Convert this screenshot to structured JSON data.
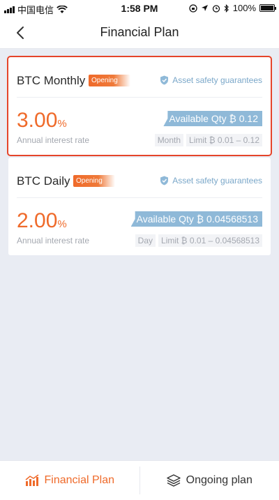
{
  "status_bar": {
    "carrier": "中国电信",
    "time": "1:58 PM",
    "battery": "100%"
  },
  "nav": {
    "title": "Financial Plan"
  },
  "plans": [
    {
      "name": "BTC Monthly",
      "badge": "Opening",
      "safety": "Asset safety guarantees",
      "rate": "3.00",
      "rate_unit": "%",
      "rate_label": "Annual interest rate",
      "available": "Available Qty ₿ 0.12",
      "period": "Month",
      "limit": "Limit ₿ 0.01 – 0.12"
    },
    {
      "name": "BTC Daily",
      "badge": "Opening",
      "safety": "Asset safety guarantees",
      "rate": "2.00",
      "rate_unit": "%",
      "rate_label": "Annual interest rate",
      "available": "Available Qty ₿ 0.04568513",
      "period": "Day",
      "limit": "Limit ₿ 0.01 – 0.04568513"
    }
  ],
  "tabs": [
    {
      "label": "Financial Plan",
      "icon": "bar-chart-icon",
      "active": true
    },
    {
      "label": "Ongoing plan",
      "icon": "layers-icon",
      "active": false
    }
  ],
  "colors": {
    "accent": "#ef6a2a",
    "highlight_border": "#e5442a",
    "info_blue": "#8fb9d8",
    "background": "#e9ecf3"
  }
}
